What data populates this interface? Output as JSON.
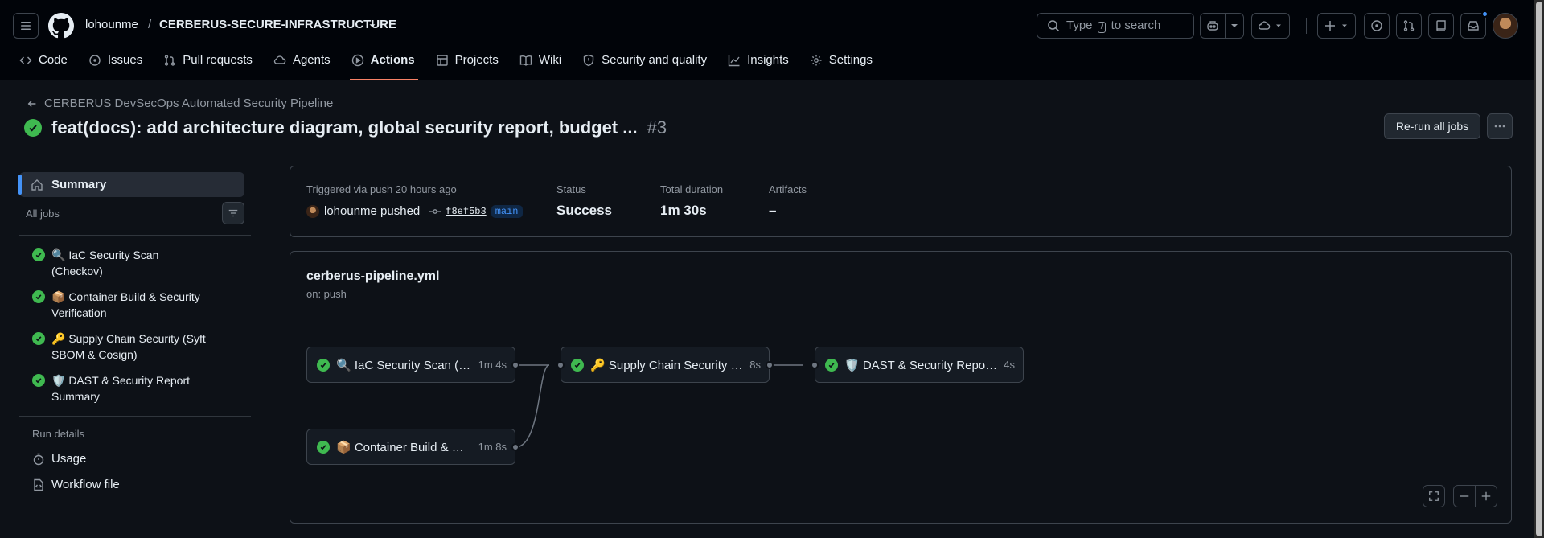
{
  "header": {
    "owner": "lohounme",
    "separator": "/",
    "repo": "CERBERUS-SECURE-INFRASTRUCTURE",
    "search_prefix": "Type",
    "search_key": "/",
    "search_suffix": "to search"
  },
  "repo_tabs": [
    {
      "label": "Code",
      "icon": "code-icon"
    },
    {
      "label": "Issues",
      "icon": "issues-icon"
    },
    {
      "label": "Pull requests",
      "icon": "pull-request-icon"
    },
    {
      "label": "Agents",
      "icon": "agents-icon"
    },
    {
      "label": "Actions",
      "icon": "actions-icon",
      "active": true
    },
    {
      "label": "Projects",
      "icon": "projects-icon"
    },
    {
      "label": "Wiki",
      "icon": "wiki-icon"
    },
    {
      "label": "Security and quality",
      "icon": "shield-icon"
    },
    {
      "label": "Insights",
      "icon": "insights-icon"
    },
    {
      "label": "Settings",
      "icon": "gear-icon"
    }
  ],
  "run": {
    "workflow_name": "CERBERUS DevSecOps Automated Security Pipeline",
    "title": "feat(docs): add architecture diagram, global security report, budget ...",
    "number": "#3",
    "rerun_label": "Re-run all jobs"
  },
  "sidebar": {
    "summary_label": "Summary",
    "all_jobs_label": "All jobs",
    "jobs": [
      {
        "line1": "🔍 IaC Security Scan",
        "line2": "(Checkov)"
      },
      {
        "line1": "📦 Container Build & Security",
        "line2": "Verification"
      },
      {
        "line1": "🔑 Supply Chain Security (Syft",
        "line2": "SBOM & Cosign)"
      },
      {
        "line1": "🛡️ DAST & Security Report",
        "line2": "Summary"
      }
    ],
    "run_details_label": "Run details",
    "usage_label": "Usage",
    "workflow_file_label": "Workflow file"
  },
  "summary_card": {
    "triggered": "Triggered via push 20 hours ago",
    "actor": "lohounme pushed",
    "commit": "f8ef5b3",
    "branch": "main",
    "status_label": "Status",
    "status_value": "Success",
    "duration_label": "Total duration",
    "duration_value": "1m 30s",
    "artifacts_label": "Artifacts",
    "artifacts_value": "–"
  },
  "graph": {
    "file": "cerberus-pipeline.yml",
    "trigger": "on: push",
    "nodes": [
      {
        "name": "🔍 IaC Security Scan (Checkov)",
        "duration": "1m 4s"
      },
      {
        "name": "🔑 Supply Chain Security (Syft SBOM & Cosign)",
        "duration": "8s"
      },
      {
        "name": "🛡️ DAST & Security Report Summary",
        "duration": "4s"
      },
      {
        "name": "📦 Container Build & Security Verification",
        "duration": "1m 8s"
      }
    ]
  },
  "colors": {
    "success": "#3fb950",
    "accent": "#4493f8",
    "tab_underline": "#f78166"
  }
}
